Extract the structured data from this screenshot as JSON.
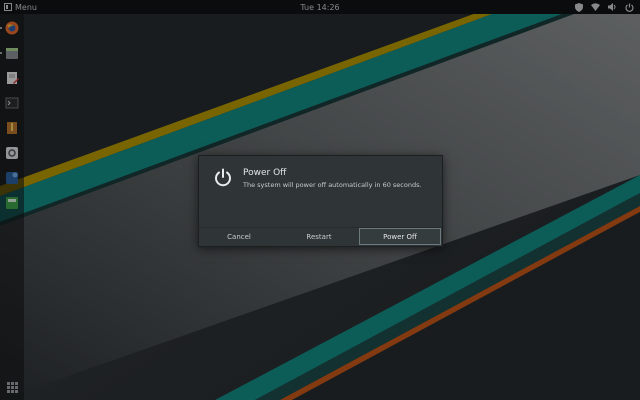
{
  "topbar": {
    "menu_label": "Menu",
    "clock": "Tue 14:26",
    "tray_icons": [
      "shield-icon",
      "wifi-icon",
      "volume-icon",
      "power-icon"
    ]
  },
  "dock": {
    "apps": [
      "firefox-icon",
      "file-manager-icon",
      "text-editor-icon",
      "terminal-icon",
      "archive-manager-icon",
      "settings-icon",
      "software-update-icon",
      "calculator-icon"
    ],
    "apps_grid_icon": "apps-grid-icon"
  },
  "dialog": {
    "title": "Power Off",
    "message": "The system will power off automatically in 60 seconds.",
    "buttons": {
      "cancel": "Cancel",
      "restart": "Restart",
      "power_off": "Power Off"
    }
  },
  "colors": {
    "stripe_yellow": "#b39700",
    "stripe_teal": "#128a83",
    "stripe_orange": "#c4571a",
    "dialog_bg": "#2f3537"
  }
}
